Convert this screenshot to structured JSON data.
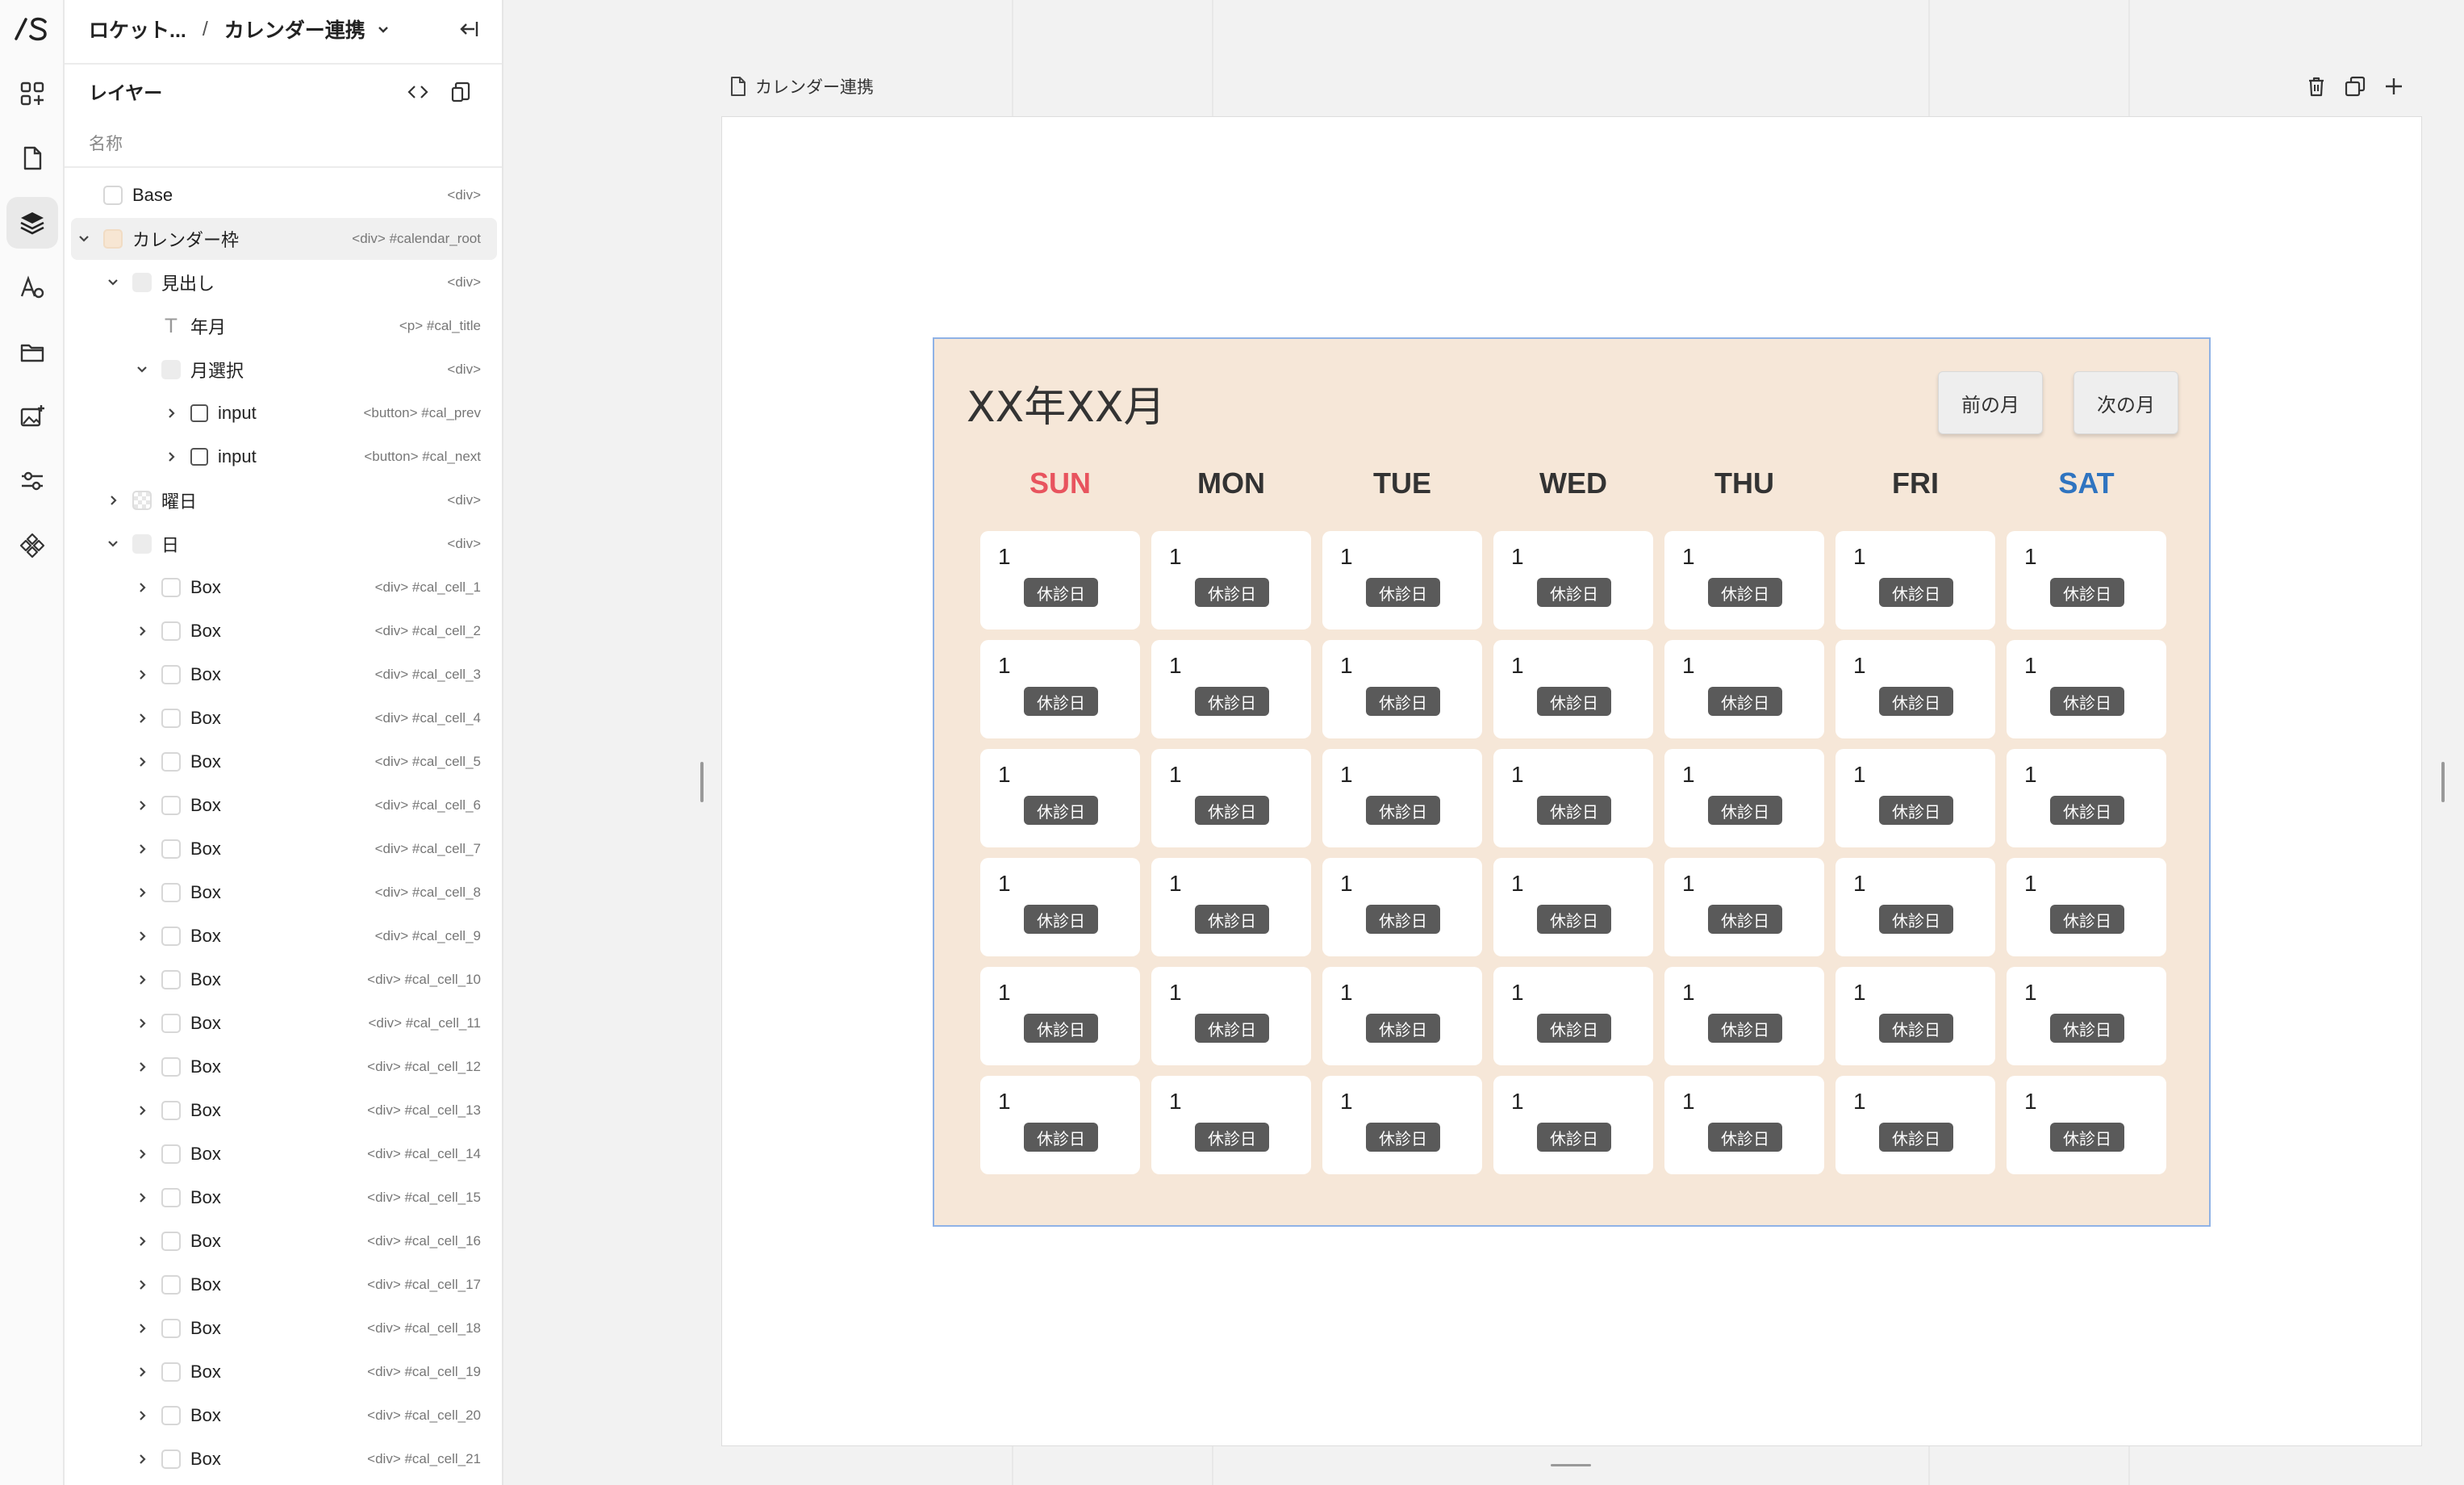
{
  "breadcrumb": {
    "project": "ロケット...",
    "separator": "/",
    "page": "カレンダー連携"
  },
  "layers_panel": {
    "title": "レイヤー",
    "search_placeholder": "名称",
    "items": [
      {
        "name": "Base",
        "tag": "<div>",
        "depth": 0,
        "expand": "none",
        "icon": "box"
      },
      {
        "name": "カレンダー枠",
        "tag": "<div> #calendar_root",
        "depth": 0,
        "expand": "down",
        "icon": "beige",
        "selected": true
      },
      {
        "name": "見出し",
        "tag": "<div>",
        "depth": 1,
        "expand": "down",
        "icon": "grey"
      },
      {
        "name": "年月",
        "tag": "<p> #cal_title",
        "depth": 2,
        "expand": "none",
        "icon": "text"
      },
      {
        "name": "月選択",
        "tag": "<div>",
        "depth": 2,
        "expand": "down",
        "icon": "grey"
      },
      {
        "name": "input",
        "tag": "<button> #cal_prev",
        "depth": 3,
        "expand": "right",
        "icon": "outline"
      },
      {
        "name": "input",
        "tag": "<button> #cal_next",
        "depth": 3,
        "expand": "right",
        "icon": "outline"
      },
      {
        "name": "曜日",
        "tag": "<div>",
        "depth": 1,
        "expand": "right",
        "icon": "checker"
      },
      {
        "name": "日",
        "tag": "<div>",
        "depth": 1,
        "expand": "down",
        "icon": "grey"
      },
      {
        "name": "Box",
        "tag": "<div> #cal_cell_1",
        "depth": 2,
        "expand": "right",
        "icon": "box"
      },
      {
        "name": "Box",
        "tag": "<div> #cal_cell_2",
        "depth": 2,
        "expand": "right",
        "icon": "box"
      },
      {
        "name": "Box",
        "tag": "<div> #cal_cell_3",
        "depth": 2,
        "expand": "right",
        "icon": "box"
      },
      {
        "name": "Box",
        "tag": "<div> #cal_cell_4",
        "depth": 2,
        "expand": "right",
        "icon": "box"
      },
      {
        "name": "Box",
        "tag": "<div> #cal_cell_5",
        "depth": 2,
        "expand": "right",
        "icon": "box"
      },
      {
        "name": "Box",
        "tag": "<div> #cal_cell_6",
        "depth": 2,
        "expand": "right",
        "icon": "box"
      },
      {
        "name": "Box",
        "tag": "<div> #cal_cell_7",
        "depth": 2,
        "expand": "right",
        "icon": "box"
      },
      {
        "name": "Box",
        "tag": "<div> #cal_cell_8",
        "depth": 2,
        "expand": "right",
        "icon": "box"
      },
      {
        "name": "Box",
        "tag": "<div> #cal_cell_9",
        "depth": 2,
        "expand": "right",
        "icon": "box"
      },
      {
        "name": "Box",
        "tag": "<div> #cal_cell_10",
        "depth": 2,
        "expand": "right",
        "icon": "box"
      },
      {
        "name": "Box",
        "tag": "<div> #cal_cell_11",
        "depth": 2,
        "expand": "right",
        "icon": "box"
      },
      {
        "name": "Box",
        "tag": "<div> #cal_cell_12",
        "depth": 2,
        "expand": "right",
        "icon": "box"
      },
      {
        "name": "Box",
        "tag": "<div> #cal_cell_13",
        "depth": 2,
        "expand": "right",
        "icon": "box"
      },
      {
        "name": "Box",
        "tag": "<div> #cal_cell_14",
        "depth": 2,
        "expand": "right",
        "icon": "box"
      },
      {
        "name": "Box",
        "tag": "<div> #cal_cell_15",
        "depth": 2,
        "expand": "right",
        "icon": "box"
      },
      {
        "name": "Box",
        "tag": "<div> #cal_cell_16",
        "depth": 2,
        "expand": "right",
        "icon": "box"
      },
      {
        "name": "Box",
        "tag": "<div> #cal_cell_17",
        "depth": 2,
        "expand": "right",
        "icon": "box"
      },
      {
        "name": "Box",
        "tag": "<div> #cal_cell_18",
        "depth": 2,
        "expand": "right",
        "icon": "box"
      },
      {
        "name": "Box",
        "tag": "<div> #cal_cell_19",
        "depth": 2,
        "expand": "right",
        "icon": "box"
      },
      {
        "name": "Box",
        "tag": "<div> #cal_cell_20",
        "depth": 2,
        "expand": "right",
        "icon": "box"
      },
      {
        "name": "Box",
        "tag": "<div> #cal_cell_21",
        "depth": 2,
        "expand": "right",
        "icon": "box"
      }
    ]
  },
  "canvas": {
    "page_label": "カレンダー連携",
    "tools": [
      "trash-icon",
      "duplicate-icon",
      "add-icon"
    ]
  },
  "calendar": {
    "title": "XX年XX月",
    "prev_label": "前の月",
    "next_label": "次の月",
    "weekdays": [
      {
        "label": "SUN",
        "color": "#e8545e"
      },
      {
        "label": "MON",
        "color": "#333333"
      },
      {
        "label": "TUE",
        "color": "#333333"
      },
      {
        "label": "WED",
        "color": "#333333"
      },
      {
        "label": "THU",
        "color": "#333333"
      },
      {
        "label": "FRI",
        "color": "#333333"
      },
      {
        "label": "SAT",
        "color": "#2f74c0"
      }
    ],
    "rows": 6,
    "cell_day": "1",
    "cell_badge": "休診日"
  },
  "colors": {
    "calendar_bg": "#f6e7d8",
    "selection_border": "#8fb2e6",
    "badge_bg": "#5a5a5a"
  }
}
